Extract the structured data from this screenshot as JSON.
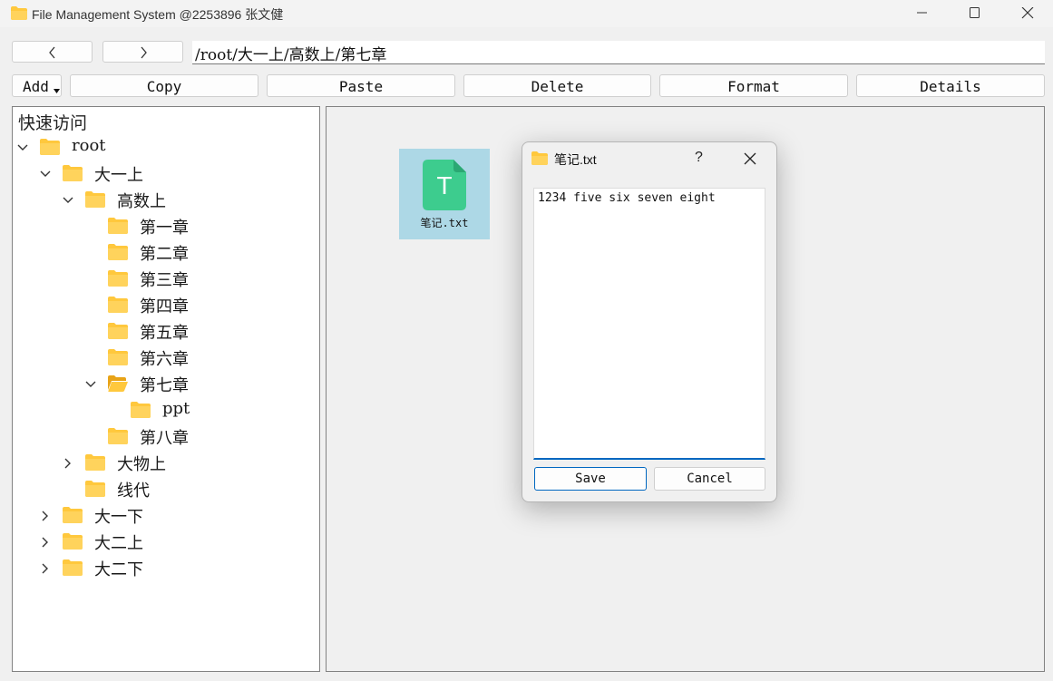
{
  "window": {
    "title": "File Management System @2253896 张文健"
  },
  "nav": {
    "back_icon": "chevron-left-icon",
    "forward_icon": "chevron-right-icon",
    "path": "/root/大一上/高数上/第七章"
  },
  "toolbar": {
    "add_label": "Add",
    "copy_label": "Copy",
    "paste_label": "Paste",
    "delete_label": "Delete",
    "format_label": "Format",
    "details_label": "Details"
  },
  "tree": {
    "header": "快速访问",
    "items": [
      {
        "label": "root",
        "expander": "expanded",
        "icon": "folder-icon"
      },
      {
        "label": "大一上",
        "expander": "expanded",
        "icon": "folder-icon"
      },
      {
        "label": "高数上",
        "expander": "expanded",
        "icon": "folder-icon"
      },
      {
        "label": "第一章",
        "expander": "none",
        "icon": "folder-icon"
      },
      {
        "label": "第二章",
        "expander": "none",
        "icon": "folder-icon"
      },
      {
        "label": "第三章",
        "expander": "none",
        "icon": "folder-icon"
      },
      {
        "label": "第四章",
        "expander": "none",
        "icon": "folder-icon"
      },
      {
        "label": "第五章",
        "expander": "none",
        "icon": "folder-icon"
      },
      {
        "label": "第六章",
        "expander": "none",
        "icon": "folder-icon"
      },
      {
        "label": "第七章",
        "expander": "expanded",
        "icon": "folder-open-icon"
      },
      {
        "label": "ppt",
        "expander": "none",
        "icon": "folder-icon"
      },
      {
        "label": "第八章",
        "expander": "none",
        "icon": "folder-icon"
      },
      {
        "label": "大物上",
        "expander": "collapsed",
        "icon": "folder-icon"
      },
      {
        "label": "线代",
        "expander": "none",
        "icon": "folder-icon"
      },
      {
        "label": "大一下",
        "expander": "collapsed",
        "icon": "folder-icon"
      },
      {
        "label": "大二上",
        "expander": "collapsed",
        "icon": "folder-icon"
      },
      {
        "label": "大二下",
        "expander": "collapsed",
        "icon": "folder-icon"
      }
    ]
  },
  "content": {
    "files": [
      {
        "name": "笔记.txt",
        "icon": "text-file-icon",
        "icon_letter": "T",
        "selected": true
      }
    ]
  },
  "dialog": {
    "title": "笔记.txt",
    "help_label": "?",
    "text": "1234 five six seven eight",
    "save_label": "Save",
    "cancel_label": "Cancel"
  },
  "colors": {
    "folder": "#ffc83d",
    "folder_dark": "#e8a317",
    "selection": "#add8e6",
    "file_icon": "#3dcc8e",
    "accent": "#0067c0"
  }
}
